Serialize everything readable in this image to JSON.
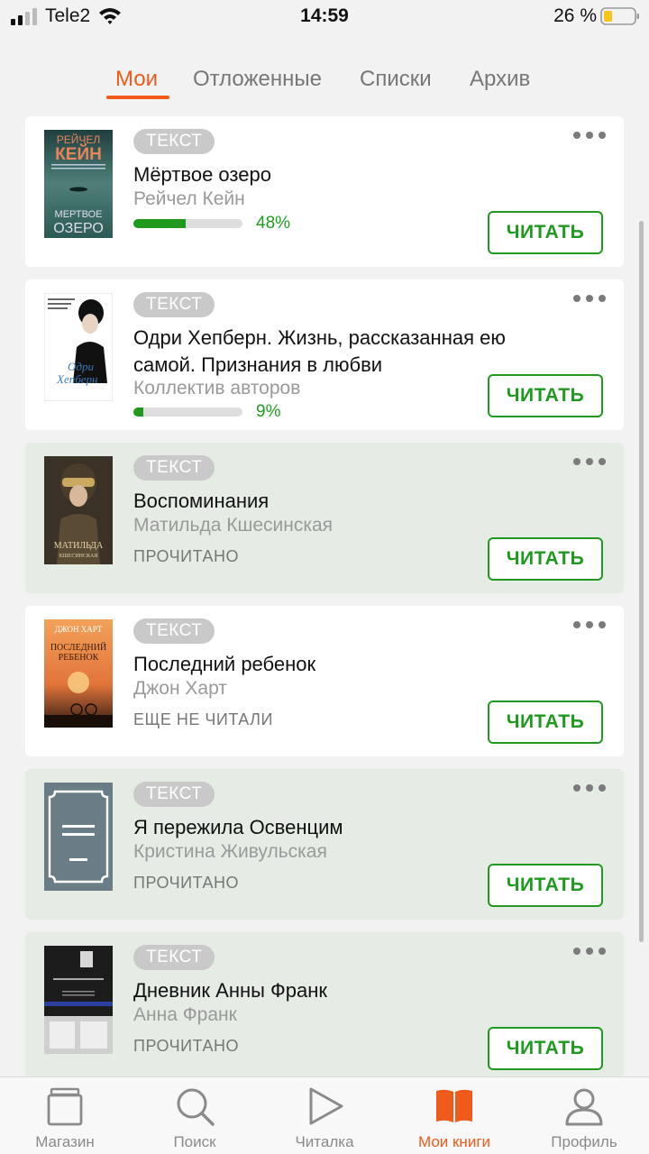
{
  "status_bar": {
    "carrier": "Tele2",
    "time": "14:59",
    "battery": "26 %"
  },
  "tabs": [
    {
      "label": "Мои",
      "active": true
    },
    {
      "label": "Отложенные",
      "active": false
    },
    {
      "label": "Списки",
      "active": false
    },
    {
      "label": "Архив",
      "active": false
    }
  ],
  "books": [
    {
      "badge": "ТЕКСТ",
      "title": "Мёртвое озеро",
      "author": "Рейчел Кейн",
      "progress": 48,
      "progress_label": "48%",
      "button": "ЧИТАТЬ",
      "cover": {
        "top_text": "РЕЙЧЕЛ",
        "top_text2": "КЕЙН",
        "bottom_text": "МЕРТВОЕ",
        "bottom_text2": "ОЗЕРО"
      }
    },
    {
      "badge": "ТЕКСТ",
      "title": "Одри Хепберн. Жизнь, рассказанная ею самой. Признания в любви",
      "author": "Коллектив авторов",
      "progress": 9,
      "progress_label": "9%",
      "button": "ЧИТАТЬ",
      "cover": {
        "name_text": "Одри",
        "name_text2": "Хепберн"
      }
    },
    {
      "badge": "ТЕКСТ",
      "title": "Воспоминания",
      "author": "Матильда Кшесинская",
      "status": "ПРОЧИТАНО",
      "button": "ЧИТАТЬ",
      "cover": {
        "name_text": "МАТИЛЬДА",
        "name_text2": "КШЕСИНСКАЯ"
      }
    },
    {
      "badge": "ТЕКСТ",
      "title": "Последний ребенок",
      "author": "Джон Харт",
      "status": "ЕЩЕ НЕ ЧИТАЛИ",
      "button": "ЧИТАТЬ",
      "cover": {
        "top_text": "ДЖОН ХАРТ",
        "title_text": "ПОСЛЕДНИЙ",
        "title_text2": "РЕБЕНОК"
      }
    },
    {
      "badge": "ТЕКСТ",
      "title": "Я пережила Освенцим",
      "author": "Кристина Живульская",
      "status": "ПРОЧИТАНО",
      "button": "ЧИТАТЬ"
    },
    {
      "badge": "ТЕКСТ",
      "title": "Дневник Анны Франк",
      "author": "Анна Франк",
      "status": "ПРОЧИТАНО",
      "button": "ЧИТАТЬ"
    }
  ],
  "bottom_nav": [
    {
      "label": "Магазин",
      "icon": "store-icon",
      "active": false
    },
    {
      "label": "Поиск",
      "icon": "search-icon",
      "active": false
    },
    {
      "label": "Читалка",
      "icon": "play-icon",
      "active": false
    },
    {
      "label": "Мои книги",
      "icon": "book-icon",
      "active": true
    },
    {
      "label": "Профиль",
      "icon": "profile-icon",
      "active": false
    }
  ],
  "colors": {
    "accent": "#f05a1a",
    "green": "#1f9a1f",
    "read_card_bg": "#e4ece4"
  }
}
